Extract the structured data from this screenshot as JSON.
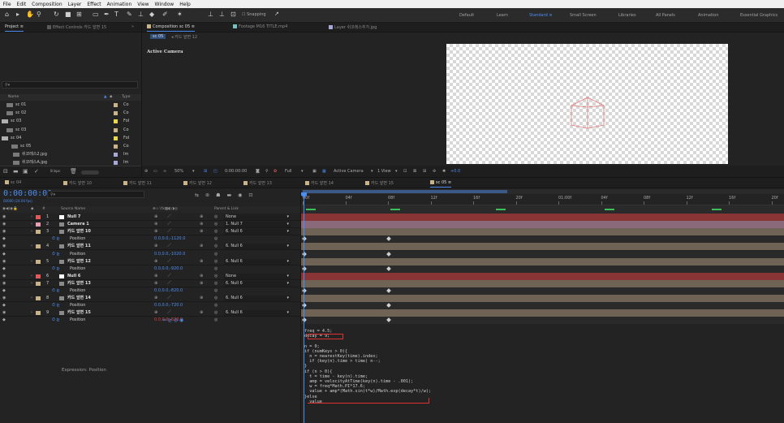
{
  "menu": [
    "File",
    "Edit",
    "Composition",
    "Layer",
    "Effect",
    "Animation",
    "View",
    "Window",
    "Help"
  ],
  "toolbar": {
    "snapping": "Snapping",
    "workspaces": [
      "Default",
      "Learn",
      "Standard",
      "Small Screen",
      "Libraries",
      "All Panels",
      "Animation",
      "Essential Graphics"
    ],
    "active_workspace": "Standard"
  },
  "project_panel": {
    "tab_project": "Project",
    "tab_effect": "Effect Controls 카드 앞면 15",
    "col_name": "Name",
    "col_type": "Type",
    "items": [
      {
        "name": "sc 01",
        "type": "Co",
        "color": "#c9b48a"
      },
      {
        "name": "sc 02",
        "type": "Co",
        "color": "#c9b48a"
      },
      {
        "name": "sc 03",
        "type": "Fol",
        "color": "#e8d84a"
      },
      {
        "name": "sc 03",
        "type": "Co",
        "color": "#c9b48a"
      },
      {
        "name": "sc 04",
        "type": "Fol",
        "color": "#e8d84a"
      },
      {
        "name": "sc 05",
        "type": "Co",
        "color": "#c9b48a"
      },
      {
        "name": "쉬코레스2.jpg",
        "type": "Im",
        "color": "#a8a8d8"
      },
      {
        "name": "쉬코레스A.jpg",
        "type": "Im",
        "color": "#a8a8d8"
      }
    ],
    "bpc": "8 bpc"
  },
  "viewer": {
    "tabs": [
      "Composition sc 05",
      "Footage M16 TITLE.mp4",
      "Layer 쉬코레스추가.jpg"
    ],
    "subtabs": [
      "sc 05",
      "카드 앞면 12"
    ],
    "active_camera_label": "Active Camera",
    "zoom": "50%",
    "timecode": "0:00:00:00",
    "resolution": "Full",
    "view": "Active Camera",
    "views": "1 View",
    "exposure": "+0.0"
  },
  "timeline": {
    "comp_tabs": [
      "sc 04",
      "카드 앞면 10",
      "카드 앞면 11",
      "카드 앞면 12",
      "카드 앞면 13",
      "카드 앞면 14",
      "카드 앞면 15",
      "sc 05"
    ],
    "timecode": "0:00:00:00",
    "timecode_sub": "00000 (24.00 fps)",
    "search_placeholder": "",
    "col_source": "Source Name",
    "col_parent": "Parent & Link",
    "ruler": [
      "00f",
      "04f",
      "08f",
      "12f",
      "16f",
      "20f",
      "01:00f",
      "04f",
      "08f",
      "12f",
      "16f",
      "20f"
    ],
    "layers": [
      {
        "num": "1",
        "name": "Null 7",
        "color": "#e05a5a",
        "parent": "None",
        "kind": "layer"
      },
      {
        "num": "2",
        "name": "Camera 1",
        "color": "#e8a0b0",
        "parent": "1. Null 7",
        "kind": "layer"
      },
      {
        "num": "3",
        "name": "카드 앞면 10",
        "color": "#c9b48a",
        "parent": "6. Null 6",
        "kind": "layer"
      },
      {
        "num": "",
        "name": "Position",
        "value": "0.0,0.0,-1120.0",
        "kind": "prop"
      },
      {
        "num": "4",
        "name": "카드 앞면 11",
        "color": "#c9b48a",
        "parent": "6. Null 6",
        "kind": "layer"
      },
      {
        "num": "",
        "name": "Position",
        "value": "0.0,0.0,-1020.0",
        "kind": "prop"
      },
      {
        "num": "5",
        "name": "카드 앞면 12",
        "color": "#c9b48a",
        "parent": "6. Null 6",
        "kind": "layer"
      },
      {
        "num": "",
        "name": "Position",
        "value": "0.0,0.0,-920.0",
        "kind": "prop"
      },
      {
        "num": "6",
        "name": "Null 6",
        "color": "#e05a5a",
        "parent": "None",
        "kind": "layer"
      },
      {
        "num": "7",
        "name": "카드 앞면 13",
        "color": "#c9b48a",
        "parent": "6. Null 6",
        "kind": "layer"
      },
      {
        "num": "",
        "name": "Position",
        "value": "0.0,0.0,-820.0",
        "kind": "prop"
      },
      {
        "num": "8",
        "name": "카드 앞면 14",
        "color": "#c9b48a",
        "parent": "6. Null 6",
        "kind": "layer"
      },
      {
        "num": "",
        "name": "Position",
        "value": "0.0,0.0,-720.0",
        "kind": "prop"
      },
      {
        "num": "9",
        "name": "카드 앞면 15",
        "color": "#c9b48a",
        "parent": "6. Null 6",
        "kind": "layer"
      },
      {
        "num": "",
        "name": "Position",
        "value": "0.0,0.0,-620.0",
        "kind": "prop",
        "red": true
      }
    ],
    "expression_label": "Expression: Position",
    "expression_lines": [
      "freq = 4.5;",
      "decay = 9;",
      "",
      "n = 0;",
      "if (numKeys > 0){",
      "  n = nearestKey(time).index;",
      "  if (key(n).time > time) n--;",
      "}",
      "if (n > 0){",
      "  t = time - key(n).time;",
      "  amp = velocityAtTime(key(n).time - .001);",
      "  w = freq*Math.PI*17.6;",
      "  value + amp*(Math.sin(t*w)/Math.exp(decay*t)/w);",
      "}else",
      "  value"
    ]
  },
  "colors": {
    "accent": "#4d8df0",
    "track_red": "#8a3535",
    "track_tan": "#6e6355",
    "track_grey": "#5a5a5a"
  }
}
